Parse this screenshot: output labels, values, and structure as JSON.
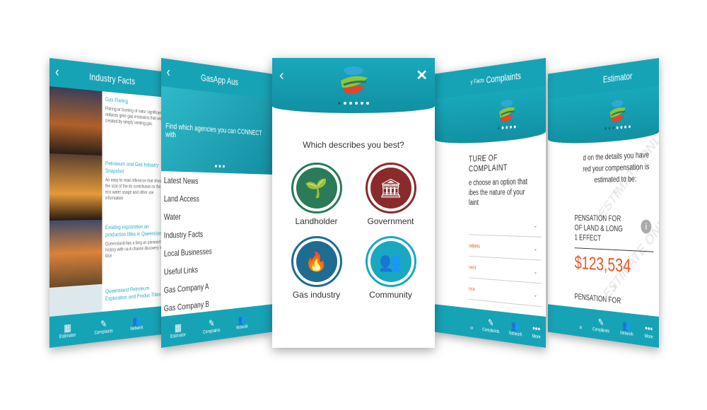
{
  "tabs": {
    "estimator": "Estimator",
    "complaints": "Complaints",
    "network": "Network",
    "more": "More",
    "partial": "or"
  },
  "p1": {
    "title": "Industry Facts",
    "items": [
      {
        "title": "Gas Flaring",
        "desc": "Flaring or burning of natur significantly reduces gree gas emissions that would created by simply venting gas."
      },
      {
        "title": "Petroleum and Gas Industry Snapshot",
        "desc": "An easy to read reference that shows the size of the its contribution to the eco water usage and other use information"
      },
      {
        "title": "Existing exploration an production titles in Queensland",
        "desc": "Queensland has a long an pioneering history with na A chance discovery in Ron"
      },
      {
        "title": "Queensland Petroleum Exploration and Produc Titles",
        "desc": ""
      }
    ]
  },
  "p2": {
    "title": "GasApp Aus",
    "banner": "Find which agencies you can CONNECT with",
    "menu": [
      "Latest News",
      "Land Access",
      "Water",
      "Industry Facts",
      "Local Businesses",
      "Useful Links",
      "Gas Company A",
      "Gas Company B"
    ]
  },
  "p3": {
    "question": "Which describes you best?",
    "options": [
      {
        "label": "Landholder",
        "color": "#2b7a5a",
        "icon": "hand-plant-icon"
      },
      {
        "label": "Government",
        "color": "#8a2b2b",
        "icon": "parliament-icon"
      },
      {
        "label": "Gas industry",
        "color": "#1f6c93",
        "icon": "flame-icon"
      },
      {
        "label": "Community",
        "color": "#1aa8c1",
        "icon": "people-icon"
      }
    ]
  },
  "p4": {
    "title_partial": "y Facts",
    "title": "Complaints",
    "heading": "TURE OF COMPLAINT",
    "prompt": [
      "e choose an option that",
      "ibes the nature of your",
      "laint"
    ],
    "rows": [
      "",
      "rations",
      "nent",
      "nce"
    ]
  },
  "p5": {
    "title": "Estimator",
    "intro": [
      "d on the details you have",
      "red your compensation is",
      "estimated to be:"
    ],
    "label": [
      "PENSATION FOR",
      "OF LAND & LONG",
      "1 EFFECT"
    ],
    "amount": "$123,534",
    "next": "PENSATION FOR",
    "watermark": "ESTIMATE ONLY"
  },
  "colors": {
    "teal": "#17a3b6",
    "orange": "#e8582a"
  }
}
